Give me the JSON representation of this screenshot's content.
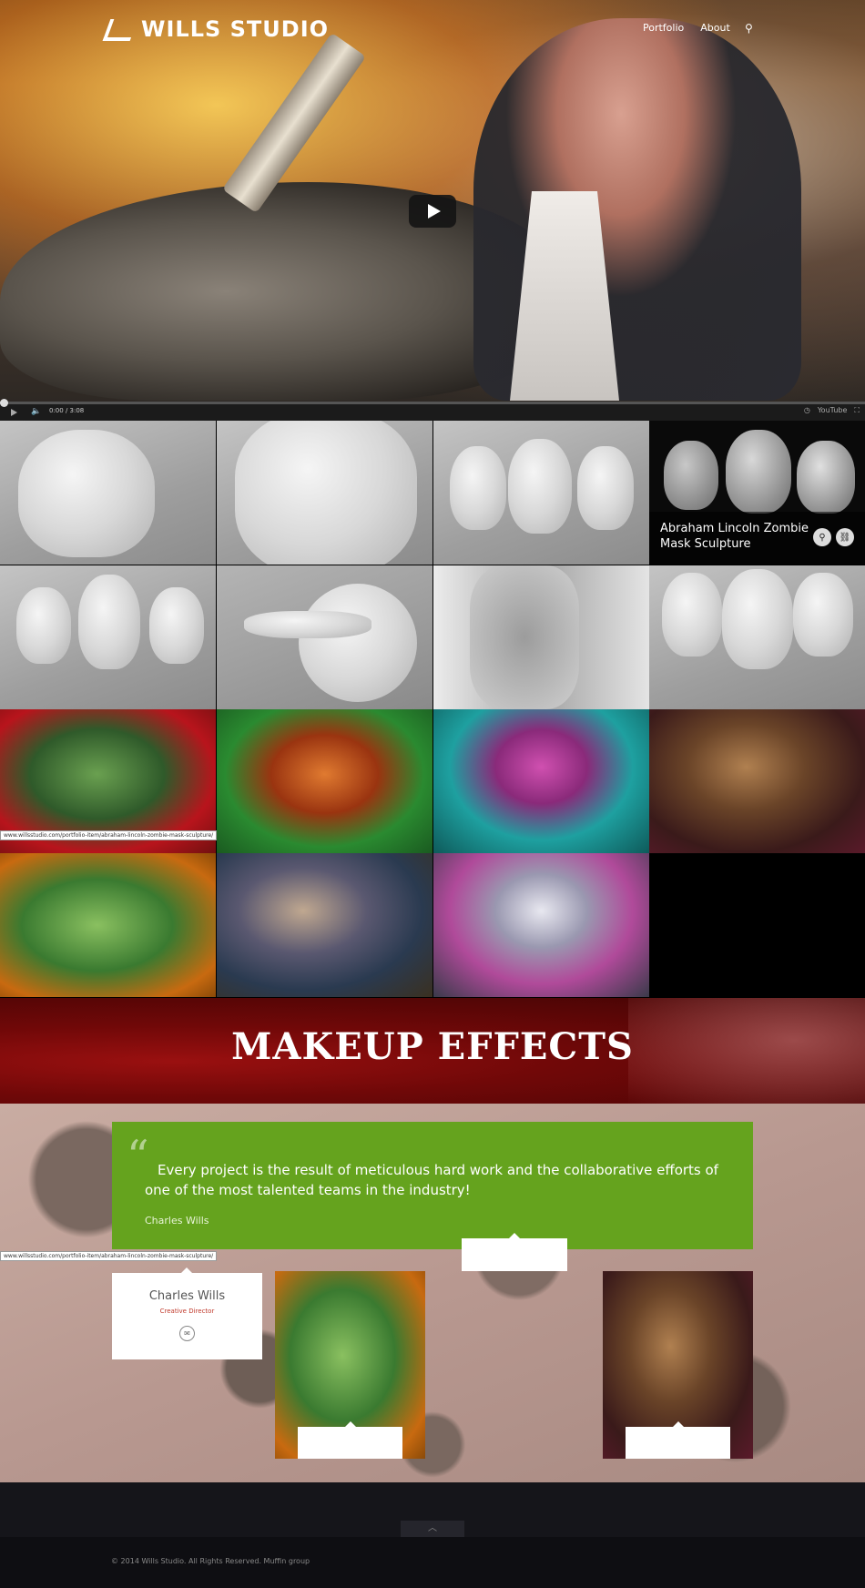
{
  "header": {
    "logo_text": "WILLS STUDIO",
    "nav": [
      {
        "label": "Portfolio"
      },
      {
        "label": "About"
      }
    ],
    "search_icon": "search-icon"
  },
  "video": {
    "time": "0:00 / 3:08",
    "brand": "YouTube"
  },
  "portfolio": {
    "hover_caption": "Abraham Lincoln Zombie Mask Sculpture",
    "url_tooltip": "www.willsstudio.com/portfolio-item/abraham-lincoln-zombie-mask-sculpture/"
  },
  "banner": {
    "title": "MAKEUP EFFECTS"
  },
  "testimonial": {
    "quote": "Every project is the result of meticulous hard work and the collaborative efforts of one of the most talented teams in the industry!",
    "author": "Charles Wills"
  },
  "team": {
    "name": "Charles Wills",
    "role": "Creative Director",
    "url_tooltip": "www.willsstudio.com/portfolio-item/abraham-lincoln-zombie-mask-sculpture/"
  },
  "footer": {
    "copyright": "© 2014 Wills Studio. All Rights Reserved. Muffin group"
  },
  "colors": {
    "accent_green": "#65a31e",
    "banner_red": "#7a0a0a",
    "role_red": "#c0392b"
  }
}
